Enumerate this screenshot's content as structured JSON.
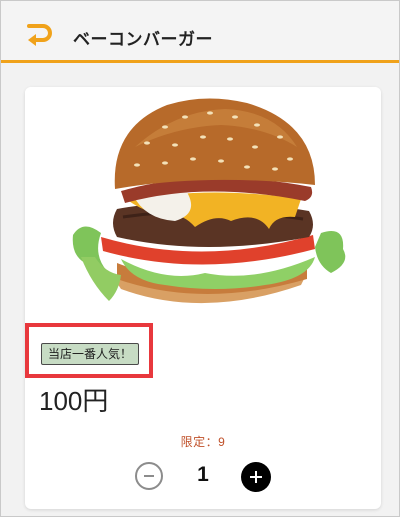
{
  "header": {
    "title": "ベーコンバーガー",
    "back_icon": "return-arrow-icon",
    "accent_color": "#f0a21a"
  },
  "product": {
    "image": "bacon-burger-photo",
    "badge_label": "当店一番人気！",
    "price": "100円",
    "limit_text": "限定：9",
    "quantity": "1",
    "minus_icon": "minus-circle-icon",
    "plus_icon": "plus-circle-icon"
  },
  "highlight_color": "#e8383d"
}
